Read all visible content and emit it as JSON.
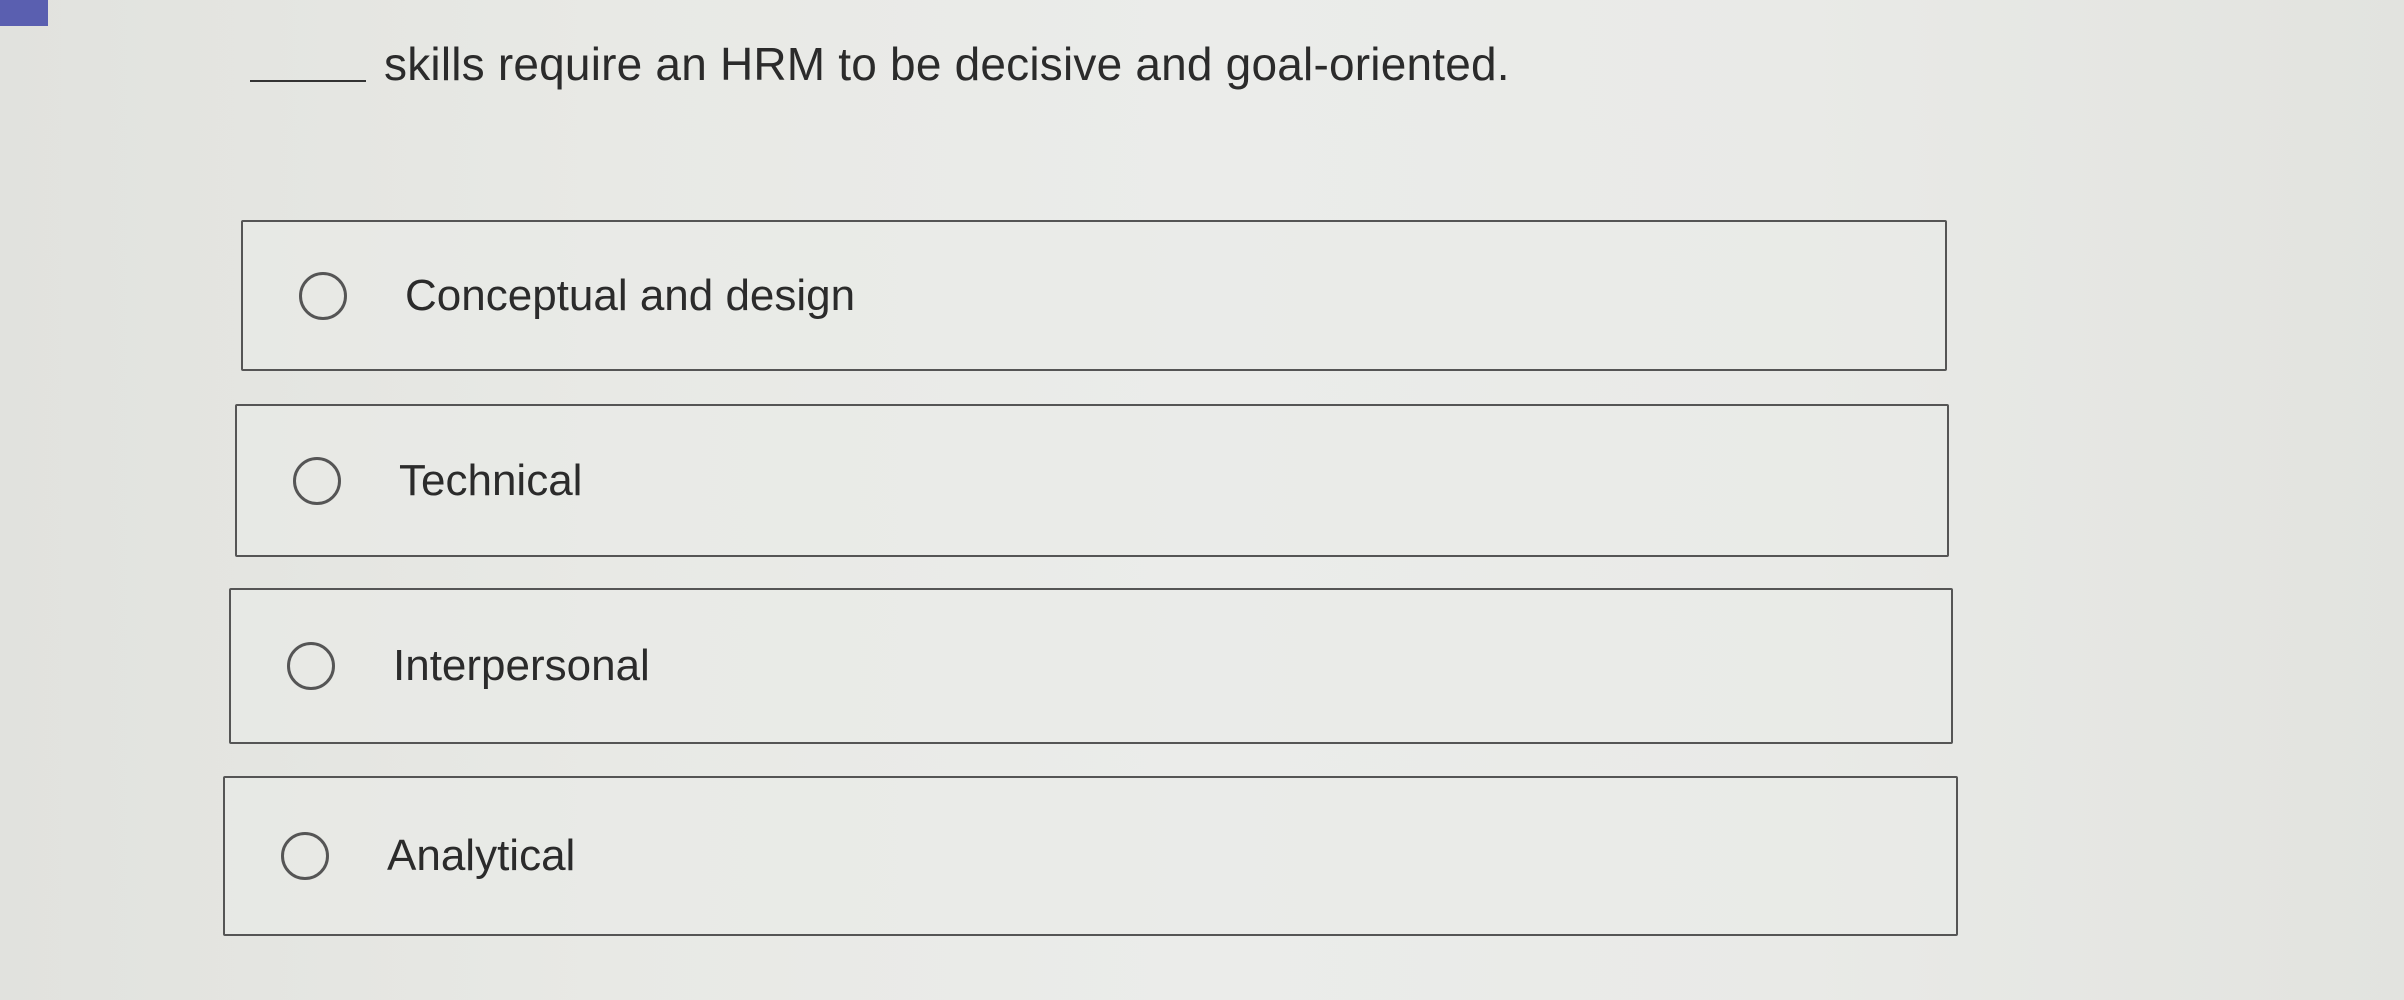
{
  "question": {
    "text": "skills require an HRM to be decisive and goal-oriented."
  },
  "options": [
    {
      "label": "Conceptual and design",
      "selected": false
    },
    {
      "label": "Technical",
      "selected": false
    },
    {
      "label": "Interpersonal",
      "selected": false
    },
    {
      "label": "Analytical",
      "selected": false
    }
  ],
  "colors": {
    "accent": "#5a5fb0",
    "border": "#555555",
    "text": "#2b2b2b",
    "background": "#e8e9e5"
  }
}
